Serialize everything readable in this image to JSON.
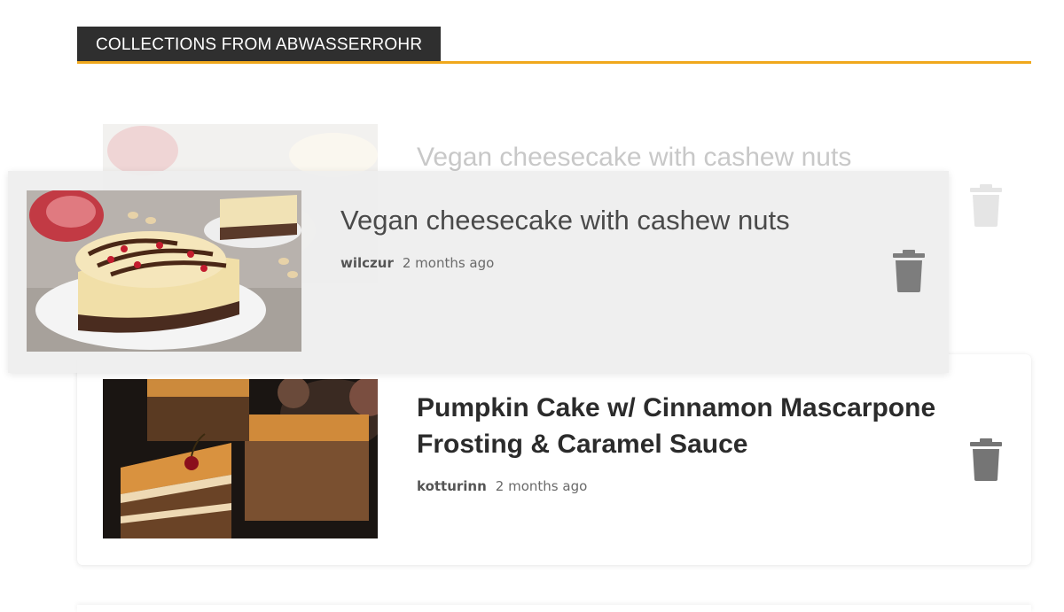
{
  "section": {
    "title": "COLLECTIONS FROM ABWASSERROHR"
  },
  "colors": {
    "accent": "#f0a81c",
    "header_bg": "#2f2f2f",
    "icon": "#757575"
  },
  "items": [
    {
      "title": "Vegan cheesecake with cashew nuts",
      "author": "wilczur",
      "time": "2 months ago",
      "image": "cheesecake-photo",
      "icon": "trash-icon",
      "state": "being-dragged"
    },
    {
      "title": "Pumpkin Cake w/ Cinnamon Mascarpone Frosting & Caramel Sauce",
      "author": "kotturinn",
      "time": "2 months ago",
      "image": "pumpkin-cake-photo",
      "icon": "trash-icon"
    }
  ]
}
